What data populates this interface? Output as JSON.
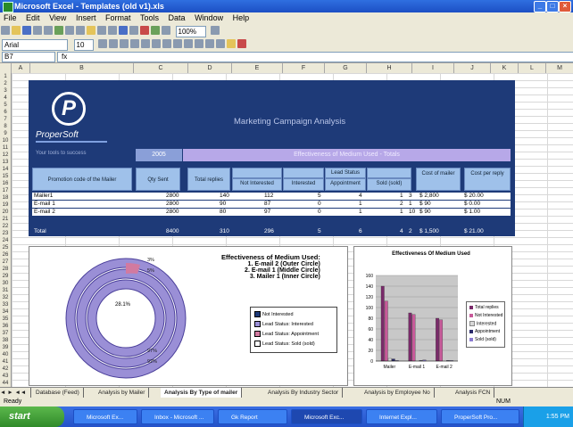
{
  "window": {
    "title": "Microsoft Excel - Templates (old v1).xls"
  },
  "menu": [
    "File",
    "Edit",
    "View",
    "Insert",
    "Format",
    "Tools",
    "Data",
    "Window",
    "Help"
  ],
  "toolbar": {
    "font": "Arial",
    "size": "10",
    "zoom": "100%"
  },
  "formula_bar": {
    "name_box": "B7",
    "fx": "fx"
  },
  "columns": [
    "A",
    "B",
    "C",
    "D",
    "E",
    "F",
    "G",
    "H",
    "I",
    "J",
    "K",
    "L",
    "M"
  ],
  "banner": {
    "company": "ProperSoft",
    "tagline": "Your tools to success",
    "report_title": "Marketing Campaign Analysis",
    "date_label": "2005",
    "effectiveness_label": "Effectiveness of Medium Used - Totals"
  },
  "table": {
    "headers": {
      "campaign": "Promotion code of the Mailer",
      "qty_sent": "Qty Sent",
      "total_replies": "Total replies",
      "lead_status": "Lead Status",
      "not_interested": "Not Interested",
      "interested": "Interested",
      "appointment": "Appointment",
      "sold": "Sold (sold)",
      "cost_of_mailer": "Cost of mailer",
      "cost_per_reply": "Cost per reply"
    },
    "rows": [
      {
        "name": "Mailer1",
        "qty": "2800",
        "replies": "140",
        "ni": "112",
        "int": "5",
        "appt": "4",
        "sold": "1",
        "sold2": "3",
        "cost": "$ 2,800",
        "cpr": "$ 20.00"
      },
      {
        "name": "E-mail 1",
        "qty": "2800",
        "replies": "90",
        "ni": "87",
        "int": "0",
        "appt": "1",
        "sold": "2",
        "sold2": "1",
        "cost": "$ 90",
        "cpr": "$ 0.00"
      },
      {
        "name": "E-mail 2",
        "qty": "2800",
        "replies": "80",
        "ni": "97",
        "int": "0",
        "appt": "1",
        "sold": "1",
        "sold2": "10",
        "cost": "$ 90",
        "cpr": "$ 1.00"
      }
    ],
    "total": {
      "name": "Total",
      "qty": "8400",
      "replies": "310",
      "ni": "296",
      "int": "5",
      "appt": "6",
      "sold": "4",
      "sold2": "2",
      "cost": "$ 1,500",
      "cpr": "$ 21.00"
    }
  },
  "donut": {
    "heading": "Effectiveness of Medium Used:",
    "lines": [
      "1. E-mail 2 (Outer Circle)",
      "2. E-mail 1 (Middle Circle)",
      "3. Mailer 1 (Inner Circle)"
    ],
    "center_label": "28.1%",
    "slice_labels": [
      "3%",
      "5%",
      "97%",
      "92%"
    ],
    "legend": [
      "Not Interested",
      "Lead Status: Interested",
      "Lead Status: Appointment",
      "Lead Status: Sold (sold)"
    ],
    "colors": {
      "ring": "#9a8fd6",
      "ring_border": "#4a3f9a",
      "pink": "#d27aa0",
      "dark": "#2a2a6a"
    }
  },
  "chart_data": {
    "type": "bar",
    "title": "Effectiveness Of Medium Used",
    "categories": [
      "Mailer",
      "E-mail 1",
      "E-mail 2"
    ],
    "series": [
      {
        "name": "Total replies",
        "values": [
          140,
          90,
          80
        ]
      },
      {
        "name": "Not Interested",
        "values": [
          112,
          87,
          77
        ]
      },
      {
        "name": "Interested",
        "values": [
          5,
          0,
          0
        ]
      },
      {
        "name": "Appointment",
        "values": [
          4,
          1,
          1
        ]
      },
      {
        "name": "Sold (sold)",
        "values": [
          1,
          2,
          1
        ]
      }
    ],
    "ylim": [
      0,
      160
    ],
    "yticks": [
      "0",
      "20",
      "40",
      "60",
      "80",
      "100",
      "120",
      "140",
      "160"
    ],
    "colors": [
      "#7a2a6a",
      "#c85a9a",
      "#d8d8d8",
      "#2a2a6a",
      "#8a7ad0"
    ]
  },
  "sheet_tabs": [
    "Database (Feed)",
    "Analysis by Mailer",
    "Analysis By Type of mailer",
    "Analysis By Industry Sector",
    "Analysis by Employee No",
    "Analysis FCN"
  ],
  "active_tab": "Analysis By Type of mailer",
  "status": {
    "left": "Ready",
    "right": "NUM"
  },
  "taskbar": {
    "start": "start",
    "tasks": [
      "Microsoft Ex...",
      "Inbox - Microsoft ...",
      "Gk Report",
      "Microsoft Exc...",
      "Internet Expl...",
      "ProperSoft Pro..."
    ],
    "clock": "1:55 PM"
  }
}
